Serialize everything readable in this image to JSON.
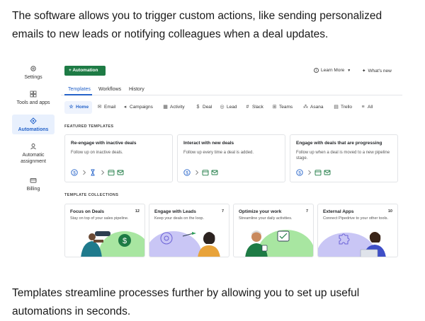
{
  "intro_text": "The software allows you to trigger custom actions, like sending personalized emails to new leads or notifying colleagues when a deal updates.",
  "outro_text": "Templates streamline processes further by allowing you to set up useful automations in seconds.",
  "sidebar": {
    "items": [
      {
        "label": "Settings",
        "icon": "gear-icon"
      },
      {
        "label": "Tools and apps",
        "icon": "tools-icon"
      },
      {
        "label": "Automations",
        "icon": "automations-icon"
      },
      {
        "label": "Automatic assignment",
        "icon": "assignment-icon"
      },
      {
        "label": "Billing",
        "icon": "credit-card-icon"
      }
    ],
    "active": "Automations"
  },
  "header": {
    "add_button": "+ Automation",
    "learn_more": "Learn More",
    "whats_new": "What's new"
  },
  "tabs": [
    "Templates",
    "Workflows",
    "History"
  ],
  "active_tab": "Templates",
  "filters": [
    "Home",
    "Email",
    "Campaigns",
    "Activity",
    "Deal",
    "Lead",
    "Slack",
    "Teams",
    "Asana",
    "Trello",
    "All"
  ],
  "featured": {
    "heading": "FEATURED TEMPLATES",
    "cards": [
      {
        "title": "Re-engage with inactive deals",
        "description": "Follow up on inactive deals."
      },
      {
        "title": "Interact with new deals",
        "description": "Follow up every time a deal is added."
      },
      {
        "title": "Engage with deals that are progressing",
        "description": "Follow up when a deal is moved to a new pipeline stage."
      }
    ]
  },
  "collections": {
    "heading": "TEMPLATE COLLECTIONS",
    "items": [
      {
        "title": "Focus on Deals",
        "count": "12",
        "description": "Stay on top of your sales pipeline."
      },
      {
        "title": "Engage with Leads",
        "count": "7",
        "description": "Keep your deals on the loop."
      },
      {
        "title": "Optimize your work",
        "count": "7",
        "description": "Streamline your daily activities."
      },
      {
        "title": "External Apps",
        "count": "10",
        "description": "Connect Pipedrive to your other tools."
      }
    ]
  },
  "colors": {
    "accent": "#2563c9",
    "brand_green": "#1e7b45",
    "illustration_green": "#a8e6a1",
    "illustration_purple": "#c9c6f5"
  }
}
